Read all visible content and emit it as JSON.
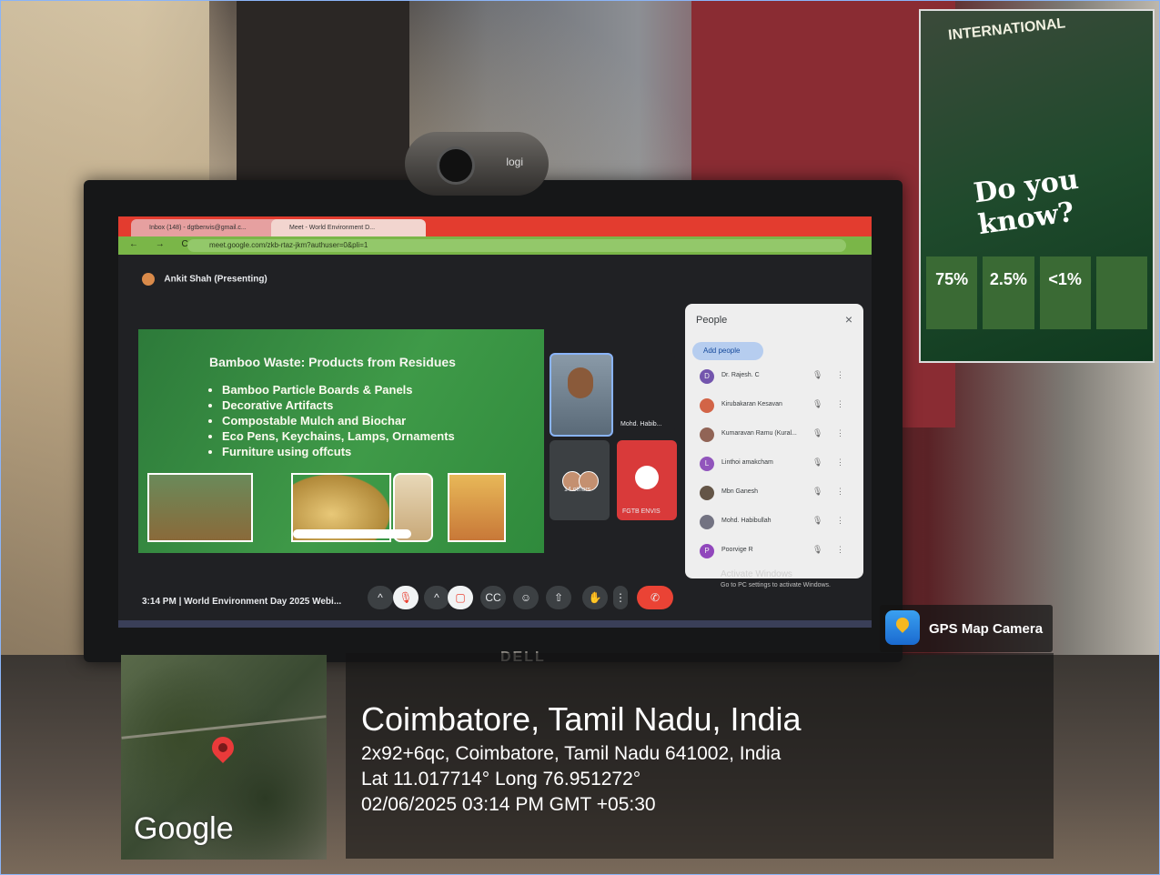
{
  "poster": {
    "headline": "Do you know?",
    "banner": "INTERNATIONAL",
    "stats": [
      "75%",
      "2.5%",
      "<1%",
      ""
    ]
  },
  "webcam": {
    "brand": "logi"
  },
  "browser": {
    "tab1_title": "Inbox (148) - dgtbenvis@gmail.c...",
    "tab2_title": "Meet - World Environment D...",
    "url": "meet.google.com/zkb-rtaz-jkm?authuser=0&pli=1",
    "nav_icons": "← → C"
  },
  "meet": {
    "presenter": "Ankit Shah (Presenting)",
    "slide": {
      "title": "Bamboo Waste: Products from Residues",
      "bullets": [
        "Bamboo Particle Boards & Panels",
        "Decorative Artifacts",
        "Compostable Mulch and Biochar",
        "Eco Pens, Keychains, Lamps, Ornaments",
        "Furniture using offcuts"
      ]
    },
    "tiles": {
      "tile2_name": "Mohd. Habib...",
      "tile3_label": "14 others",
      "tile4_label": "FGTB ENVIS"
    },
    "people_panel": {
      "title": "People",
      "close_icon": "×",
      "add_label": "Add people",
      "rows": [
        {
          "name": "Dr. Rajesh. C",
          "initial": "D",
          "color": "#7a5ab8"
        },
        {
          "name": "Kirubakaran Kesavan",
          "initial": "",
          "color": "#e06a4a"
        },
        {
          "name": "Kumaravan Ramu (Kural...",
          "initial": "",
          "color": "#9a6a5a"
        },
        {
          "name": "Linthoi amakcham",
          "initial": "L",
          "color": "#9a5ac8"
        },
        {
          "name": "Mbn Ganesh",
          "initial": "",
          "color": "#6a5a4a"
        },
        {
          "name": "Mohd. Habibullah",
          "initial": "",
          "color": "#7a7a8a"
        },
        {
          "name": "Poorvige R",
          "initial": "P",
          "color": "#9a4ac8"
        }
      ],
      "mic_off_icon": "🎙",
      "more_icon": "⋮"
    },
    "activate_windows": "Activate Windows",
    "activate_sub": "Go to PC settings to activate Windows.",
    "meeting_info": "3:14 PM | World Environment Day 2025 Webi...",
    "controls": [
      "^",
      "🎙",
      "^",
      "▢",
      "CC",
      "☺",
      "⇧",
      "✋",
      "⋮",
      "✆"
    ]
  },
  "monitor_brand": "DELL",
  "gps": {
    "app_name": "GPS Map Camera",
    "map_brand": "Google",
    "city": "Coimbatore, Tamil Nadu, India",
    "address": "2x92+6qc, Coimbatore, Tamil Nadu 641002, India",
    "coords": "Lat 11.017714° Long 76.951272°",
    "datetime": "02/06/2025 03:14 PM GMT +05:30"
  }
}
